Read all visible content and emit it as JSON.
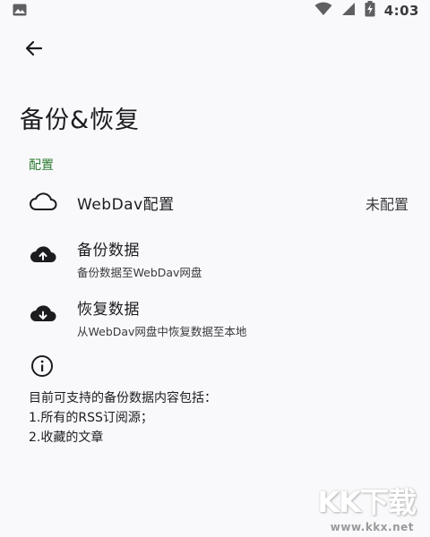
{
  "status_bar": {
    "time": "4:03",
    "icons": [
      "image-icon",
      "wifi-icon",
      "signal-icon",
      "battery-charging-icon"
    ]
  },
  "header": {
    "back_icon": "arrow-left-icon",
    "title": "备份&恢复"
  },
  "section": {
    "label": "配置",
    "accent_color": "#2e7d32"
  },
  "items": [
    {
      "icon": "cloud-icon",
      "title": "WebDav配置",
      "subtitle": "",
      "value": "未配置"
    },
    {
      "icon": "cloud-upload-icon",
      "title": "备份数据",
      "subtitle": "备份数据至WebDav网盘",
      "value": ""
    },
    {
      "icon": "cloud-download-icon",
      "title": "恢复数据",
      "subtitle": "从WebDav网盘中恢复数据至本地",
      "value": ""
    }
  ],
  "info": {
    "icon": "info-icon",
    "lines": [
      "目前可支持的备份数据内容包括：",
      "1.所有的RSS订阅源；",
      "2.收藏的文章"
    ]
  },
  "watermark": {
    "brand": "KK下载",
    "url": "www.kkx.net"
  }
}
